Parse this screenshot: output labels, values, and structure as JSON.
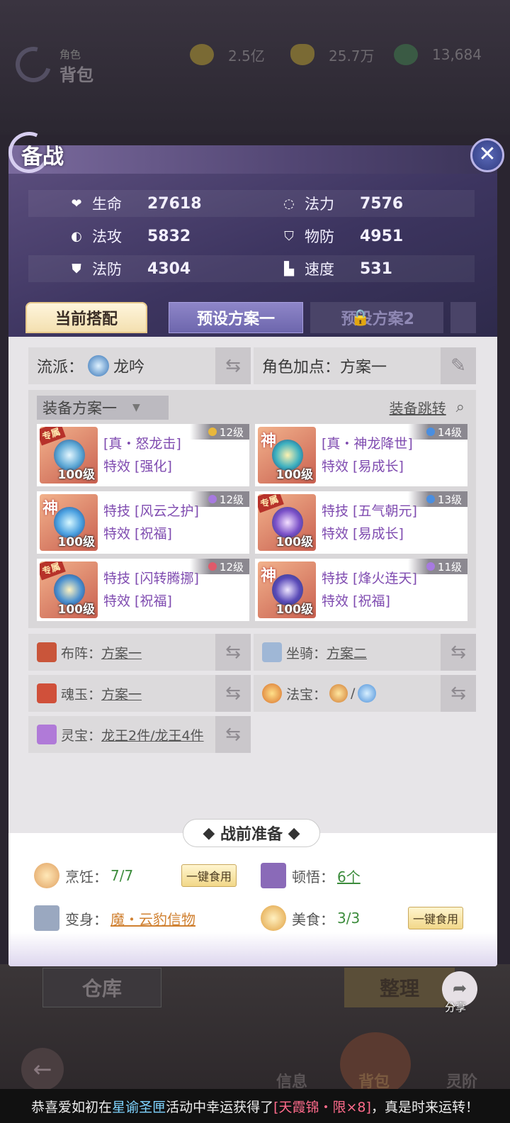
{
  "background": {
    "bag_subtitle": "角色",
    "bag_title": "背包",
    "currencies": [
      {
        "icon": "coin-icon",
        "value": "2.5亿",
        "color": "#8a7a40"
      },
      {
        "icon": "ingot-icon",
        "value": "25.7万",
        "color": "#8a7a40"
      },
      {
        "icon": "jade-icon",
        "value": "13,684",
        "color": "#3f6a4e"
      }
    ],
    "warehouse_label": "仓库",
    "sort_label": "整理",
    "share_label": "分享",
    "nav_items": [
      "信息",
      "背包",
      "灵阶"
    ]
  },
  "modal": {
    "title": "备战",
    "stats": [
      [
        {
          "icon": "heart-icon",
          "label": "生命",
          "value": "27618"
        },
        {
          "icon": "swirl-icon",
          "label": "法力",
          "value": "7576"
        }
      ],
      [
        {
          "icon": "fist-icon",
          "label": "法攻",
          "value": "5832"
        },
        {
          "icon": "shield-icon",
          "label": "物防",
          "value": "4951"
        }
      ],
      [
        {
          "icon": "armor-icon",
          "label": "法防",
          "value": "4304"
        },
        {
          "icon": "boot-icon",
          "label": "速度",
          "value": "531"
        }
      ]
    ],
    "tabs": [
      "当前搭配",
      "预设方案一",
      "预设方案2"
    ],
    "school_label": "流派：",
    "school_value": "龙吟",
    "points_label": "角色加点：",
    "points_value": "方案一",
    "equip_plan": "装备方案一",
    "equip_jump": "装备跳转",
    "equipment": [
      {
        "tag": "专属",
        "level": "100级",
        "badge": "12级",
        "badge_color": "#e8b73c",
        "line1": "[真・怒龙击]",
        "line2": "特效 [强化]"
      },
      {
        "tag": "神",
        "level": "100级",
        "badge": "14级",
        "badge_color": "#4a8ee0",
        "line1": "[真・神龙降世]",
        "line2": "特效 [易成长]"
      },
      {
        "tag": "神",
        "level": "100级",
        "badge": "12级",
        "badge_color": "#a77ae0",
        "line1": "特技 [风云之护]",
        "line2": "特效 [祝福]"
      },
      {
        "tag": "专属",
        "level": "100级",
        "badge": "13级",
        "badge_color": "#4a8ee0",
        "line1": "特技 [五气朝元]",
        "line2": "特效 [易成长]"
      },
      {
        "tag": "专属",
        "level": "100级",
        "badge": "12级",
        "badge_color": "#e05a6a",
        "line1": "特技 [闪转腾挪]",
        "line2": "特效 [祝福]"
      },
      {
        "tag": "神",
        "level": "100级",
        "badge": "11级",
        "badge_color": "#a77ae0",
        "line1": "特技 [烽火连天]",
        "line2": "特效 [祝福]"
      }
    ],
    "misc": [
      {
        "icon": "book-icon",
        "label": "布阵：",
        "value": "方案一"
      },
      {
        "icon": "mount-icon",
        "label": "坐骑：",
        "value": "方案二"
      },
      {
        "icon": "soul-jade-icon",
        "label": "魂玉：",
        "value": "方案一"
      },
      {
        "icon": "treasure-icon",
        "label": "法宝：",
        "value": "/"
      },
      {
        "icon": "spirit-box-icon",
        "label": "灵宝：",
        "value": "龙王2件/龙王4件"
      }
    ],
    "prep_title": "战前准备",
    "cooking_label": "烹饪：",
    "cooking_value": "7/7",
    "insight_label": "顿悟：",
    "insight_value": "6个",
    "transform_label": "变身：",
    "transform_value": "魔・云豹信物",
    "food_label": "美食：",
    "food_value": "3/3",
    "eat_all": "一键食用"
  },
  "ticker": {
    "p1": "恭喜爱如初在",
    "p2": "星谕圣匣",
    "p3": "活动中幸运获得了",
    "p4": "[天霞锦・限×8]",
    "p5": "，真是时来运转！"
  }
}
